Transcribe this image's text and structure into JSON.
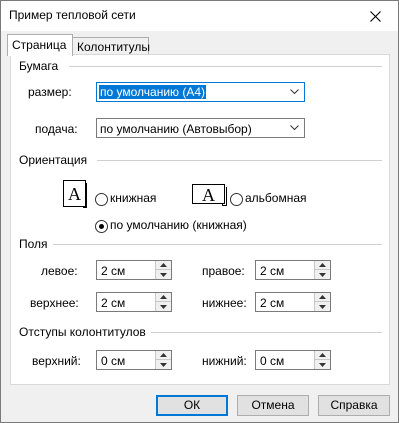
{
  "window": {
    "title": "Пример тепловой сети"
  },
  "tabs": [
    {
      "label": "Страница",
      "active": true
    },
    {
      "label": "Колонтитулы",
      "active": false
    }
  ],
  "paper": {
    "section_label": "Бумага",
    "size_label": "размер:",
    "size_value": "по умолчанию (A4)",
    "source_label": "подача:",
    "source_value": "по умолчанию (Автовыбор)"
  },
  "orientation": {
    "section_label": "Ориентация",
    "icon_letter": "A",
    "portrait_label": "книжная",
    "landscape_label": "альбомная",
    "default_label": "по умолчанию (книжная)",
    "selected": "default"
  },
  "margins": {
    "section_label": "Поля",
    "left_label": "левое:",
    "left_value": "2 см",
    "right_label": "правое:",
    "right_value": "2 см",
    "top_label": "верхнее:",
    "top_value": "2 см",
    "bottom_label": "нижнее:",
    "bottom_value": "2 см"
  },
  "header_margins": {
    "section_label": "Отступы колонтитулов",
    "top_label": "верхний:",
    "top_value": "0 см",
    "bottom_label": "нижний:",
    "bottom_value": "0 см"
  },
  "buttons": {
    "ok": "ОК",
    "cancel": "Отмена",
    "help": "Справка"
  },
  "colors": {
    "accent": "#0078d7",
    "window_bg": "#f0f0f0",
    "panel_bg": "#ffffff"
  }
}
